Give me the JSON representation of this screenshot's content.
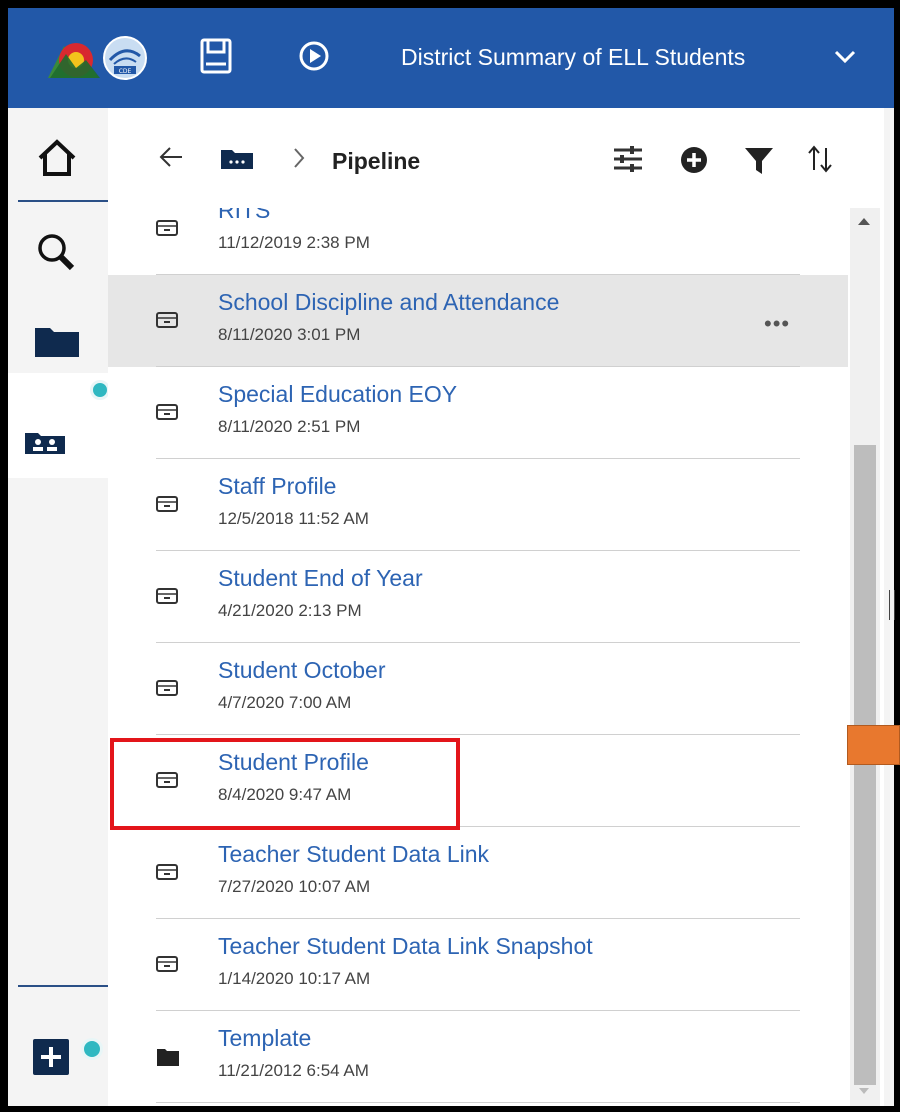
{
  "header": {
    "title": "District Summary of ELL Students",
    "icons": [
      "colorado-logo-icon",
      "cde-logo-icon",
      "save-icon",
      "play-icon",
      "chevron-down-icon"
    ],
    "background_color": "#2258a8"
  },
  "nav": {
    "items": [
      "home-icon",
      "search-icon",
      "folder-icon",
      "team-content-icon"
    ],
    "add_icon": "add-icon",
    "badge_color": "#2fb8c1"
  },
  "breadcrumb": {
    "title": "Pipeline",
    "icons": [
      "back-arrow-icon",
      "folder-icon",
      "chevron-right-icon"
    ]
  },
  "toolbar": {
    "icons": [
      "settings-sliders-icon",
      "add-circle-icon",
      "filter-icon",
      "sort-icon"
    ]
  },
  "list": {
    "link_color": "#2d64b3",
    "selected_row": "School Discipline and Attendance",
    "highlighted_item": "Student Profile",
    "more_label": "•••",
    "items": [
      {
        "name": "RITS",
        "date": "11/12/2019 2:38 PM",
        "icon": "package-icon"
      },
      {
        "name": "School Discipline and Attendance",
        "date": "8/11/2020 3:01 PM",
        "icon": "package-icon"
      },
      {
        "name": "Special Education EOY",
        "date": "8/11/2020 2:51 PM",
        "icon": "package-icon"
      },
      {
        "name": "Staff Profile",
        "date": "12/5/2018 11:52 AM",
        "icon": "package-icon"
      },
      {
        "name": "Student End of Year",
        "date": "4/21/2020 2:13 PM",
        "icon": "package-icon"
      },
      {
        "name": "Student October",
        "date": "4/7/2020 7:00 AM",
        "icon": "package-icon"
      },
      {
        "name": "Student Profile",
        "date": "8/4/2020 9:47 AM",
        "icon": "package-icon"
      },
      {
        "name": "Teacher Student Data Link",
        "date": "7/27/2020 10:07 AM",
        "icon": "package-icon"
      },
      {
        "name": "Teacher Student Data Link Snapshot",
        "date": "1/14/2020 10:17 AM",
        "icon": "package-icon"
      },
      {
        "name": "Template",
        "date": "11/21/2012 6:54 AM",
        "icon": "folder-icon"
      }
    ]
  }
}
